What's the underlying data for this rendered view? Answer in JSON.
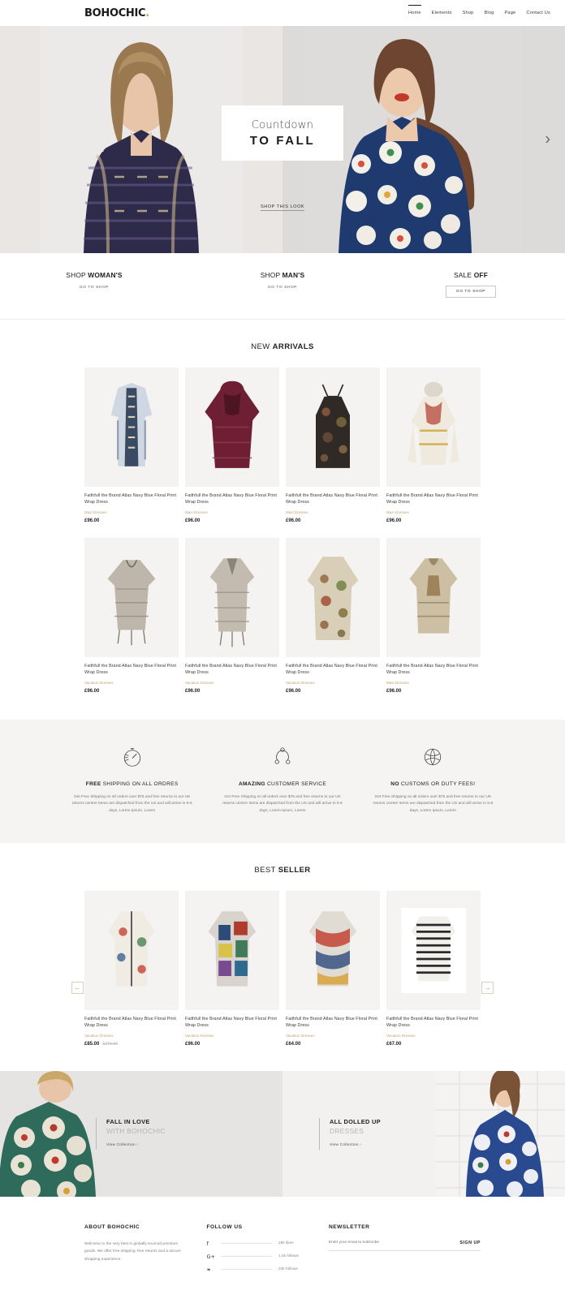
{
  "header": {
    "logo": "BOHOCHIC",
    "logo_dot": ".",
    "nav": [
      {
        "label": "Home",
        "active": true
      },
      {
        "label": "Elements",
        "active": false
      },
      {
        "label": "Shop",
        "active": false
      },
      {
        "label": "Blog",
        "active": false
      },
      {
        "label": "Page",
        "active": false
      },
      {
        "label": "Contact Us",
        "active": false
      }
    ]
  },
  "hero": {
    "subtitle": "Countdown",
    "title": "TO FALL",
    "link": "SHOP THIS LOOK",
    "next_arrow": "›"
  },
  "promos": [
    {
      "light": "SHOP ",
      "bold": "WOMAN'S",
      "link": "GO TO SHOP",
      "boxed": false
    },
    {
      "light": "SHOP ",
      "bold": "MAN'S",
      "link": "GO TO SHOP",
      "boxed": false
    },
    {
      "light": "SALE ",
      "bold": "OFF",
      "link": "GO TO SHOP",
      "boxed": true
    }
  ],
  "new_arrivals": {
    "title_light": "NEW ",
    "title_bold": "ARRIVALS",
    "products": [
      {
        "title": "Faithfull the Brand Atlas Navy Blue Floral Print Wrap Dress",
        "category": "Maxi Dresses",
        "price": "£96.00",
        "old_price": ""
      },
      {
        "title": "Faithfull the Brand Atlas Navy Blue Floral Print Wrap Dress",
        "category": "Maxi Dresses",
        "price": "£96.00",
        "old_price": ""
      },
      {
        "title": "Faithfull the Brand Atlas Navy Blue Floral Print Wrap Dress",
        "category": "Maxi Dresses",
        "price": "£96.00",
        "old_price": ""
      },
      {
        "title": "Faithfull the Brand Atlas Navy Blue Floral Print Wrap Dress",
        "category": "Maxi Dresses",
        "price": "£96.00",
        "old_price": ""
      },
      {
        "title": "Faithfull the Brand Atlas Navy Blue Floral Print Wrap Dress",
        "category": "Vacation Dresses",
        "price": "£96.00",
        "old_price": ""
      },
      {
        "title": "Faithfull the Brand Atlas Navy Blue Floral Print Wrap Dress",
        "category": "Vacation Dresses",
        "price": "£96.00",
        "old_price": ""
      },
      {
        "title": "Faithfull the Brand Atlas Navy Blue Floral Print Wrap Dress",
        "category": "Vacation Dresses",
        "price": "£96.00",
        "old_price": ""
      },
      {
        "title": "Faithfull the Brand Atlas Navy Blue Floral Print Wrap Dress",
        "category": "Maxi Dresses",
        "price": "£96.00",
        "old_price": ""
      }
    ]
  },
  "features": [
    {
      "icon": "stopwatch-icon",
      "title_bold": "FREE ",
      "title_light": "SHIPPING ON ALL ORDRES",
      "text": "Get Free Shipping on all orders over $75 and free returns to our UK returns centre! Items are dispatched from the US and will arrive in 5-8 days, Lorem Ipsum, Lorem"
    },
    {
      "icon": "support-network-icon",
      "title_bold": "AMAZING ",
      "title_light": "CUSTOMER SERVICE",
      "text": "Get Free Shipping on all orders over $75 and free returns to our UK returns centre! Items are dispatched from the US and will arrive in 5-8 days, Lorem Ipsum, Lorem"
    },
    {
      "icon": "globe-icon",
      "title_bold": "NO ",
      "title_light": "CUSTOMS OR DUTY FEES!",
      "text": "Get Free Shipping on all orders over $75 and free returns to our UK returns centre! Items are dispatched from the US and will arrive in 5-8 days, Lorem Ipsum, Lorem"
    }
  ],
  "best_seller": {
    "title_light": "BEST ",
    "title_bold": "SELLER",
    "prev_arrow": "←",
    "next_arrow": "→",
    "products": [
      {
        "title": "Faithfull the Brand Atlas Navy Blue Floral Print Wrap Dress",
        "category": "Vacation Dresses",
        "price": "£85.00",
        "old_price": "£270.00"
      },
      {
        "title": "Faithfull the Brand Atlas Navy Blue Floral Print Wrap Dress",
        "category": "Vacation Dresses",
        "price": "£96.00",
        "old_price": ""
      },
      {
        "title": "Faithfull the Brand Atlas Navy Blue Floral Print Wrap Dress",
        "category": "Vacation Dresses",
        "price": "£64.00",
        "old_price": ""
      },
      {
        "title": "Faithfull the Brand Atlas Navy Blue Floral Print Wrap Dress",
        "category": "Vacation Dresses",
        "price": "£67.00",
        "old_price": ""
      }
    ]
  },
  "lookbook": [
    {
      "line1": "FALL IN LOVE",
      "line2": "WITH BOHOCHIC",
      "link": "View Collection ›"
    },
    {
      "line1": "ALL DOLLED UP",
      "line2": "DRESSES",
      "link": "View Collection ›"
    }
  ],
  "footer": {
    "about": {
      "heading": "ABOUT BOHOCHIC",
      "text": "Welcome to the very best in globally sourced premium goods. We offer free shipping, free returns and a secure shopping experience."
    },
    "follow": {
      "heading": "FOLLOW US",
      "items": [
        {
          "icon": "facebook-icon",
          "glyph": "f",
          "count": "25k likes"
        },
        {
          "icon": "google-plus-icon",
          "glyph": "G+",
          "count": "1.5k follows"
        },
        {
          "icon": "twitter-icon",
          "glyph": "❧",
          "count": "23k follows"
        }
      ]
    },
    "newsletter": {
      "heading": "NEWSLETTER",
      "placeholder": "Enter your email to subscribe",
      "button": "SIGN UP"
    }
  },
  "colors": {
    "accent": "#c49a6c",
    "dark": "#1f1f1f",
    "muted": "#8a8a8a"
  }
}
